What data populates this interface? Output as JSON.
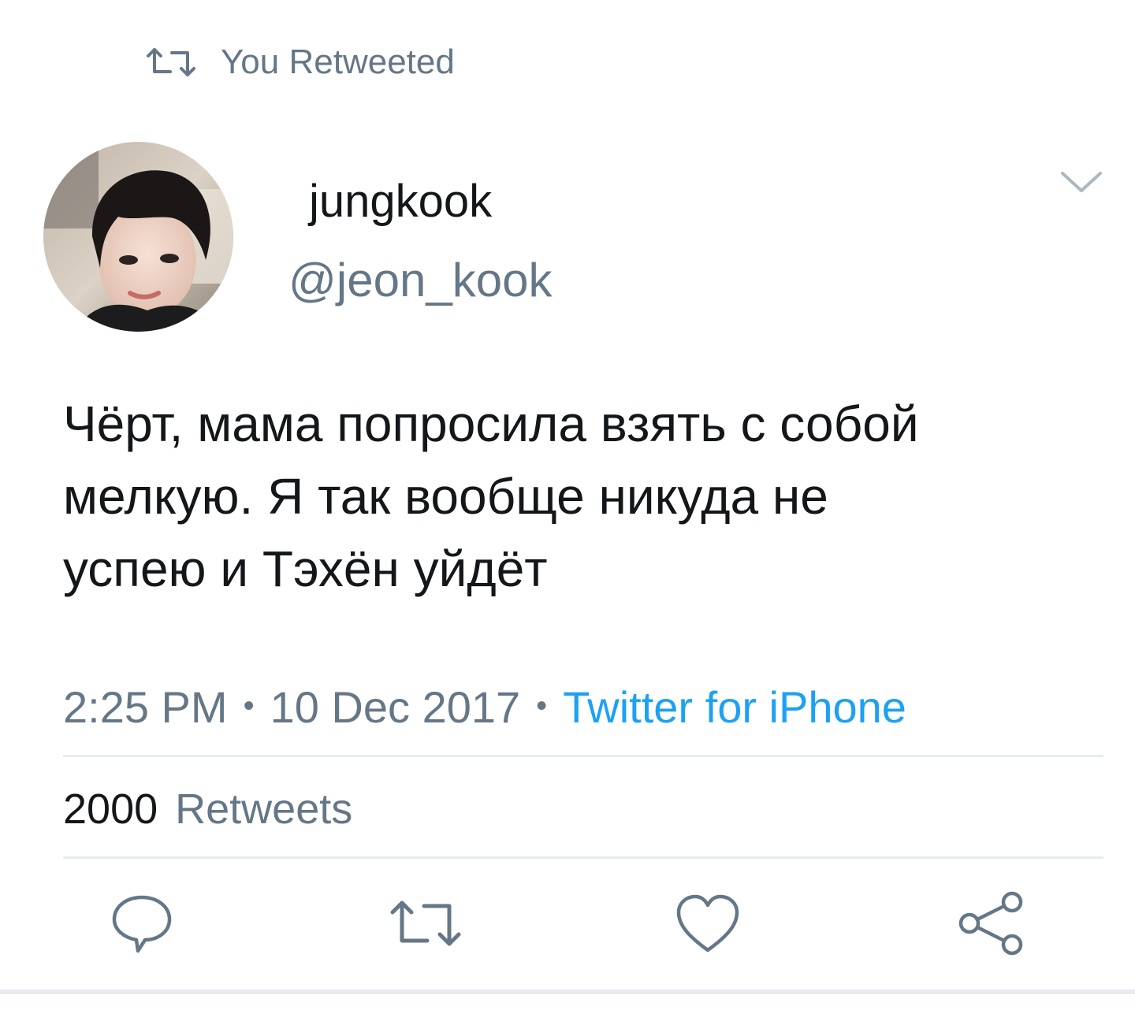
{
  "retweet_header": {
    "icon": "retweet-icon",
    "label": "You Retweeted"
  },
  "author": {
    "avatar": "user-avatar-photo",
    "display_name": "jungkook",
    "handle": "@jeon_kook"
  },
  "menu": {
    "icon": "chevron-down-icon"
  },
  "tweet": {
    "text": "Чёрт, мама попросила взять с собой\nмелкую. Я так вообще никуда не\nуспею и Тэхён уйдёт"
  },
  "meta": {
    "time": "2:25 PM",
    "separator": "•",
    "date": "10 Dec 2017",
    "source": "Twitter for iPhone"
  },
  "stats": {
    "retweet_count": "2000",
    "retweet_label": "Retweets"
  },
  "actions": [
    {
      "icon": "reply-icon"
    },
    {
      "icon": "retweet-icon"
    },
    {
      "icon": "like-heart-icon"
    },
    {
      "icon": "share-icon"
    }
  ],
  "colors": {
    "text_primary": "#14171a",
    "text_secondary": "#657786",
    "link": "#1da1f2",
    "divider": "#e6ecf0",
    "icon": "#657786"
  }
}
